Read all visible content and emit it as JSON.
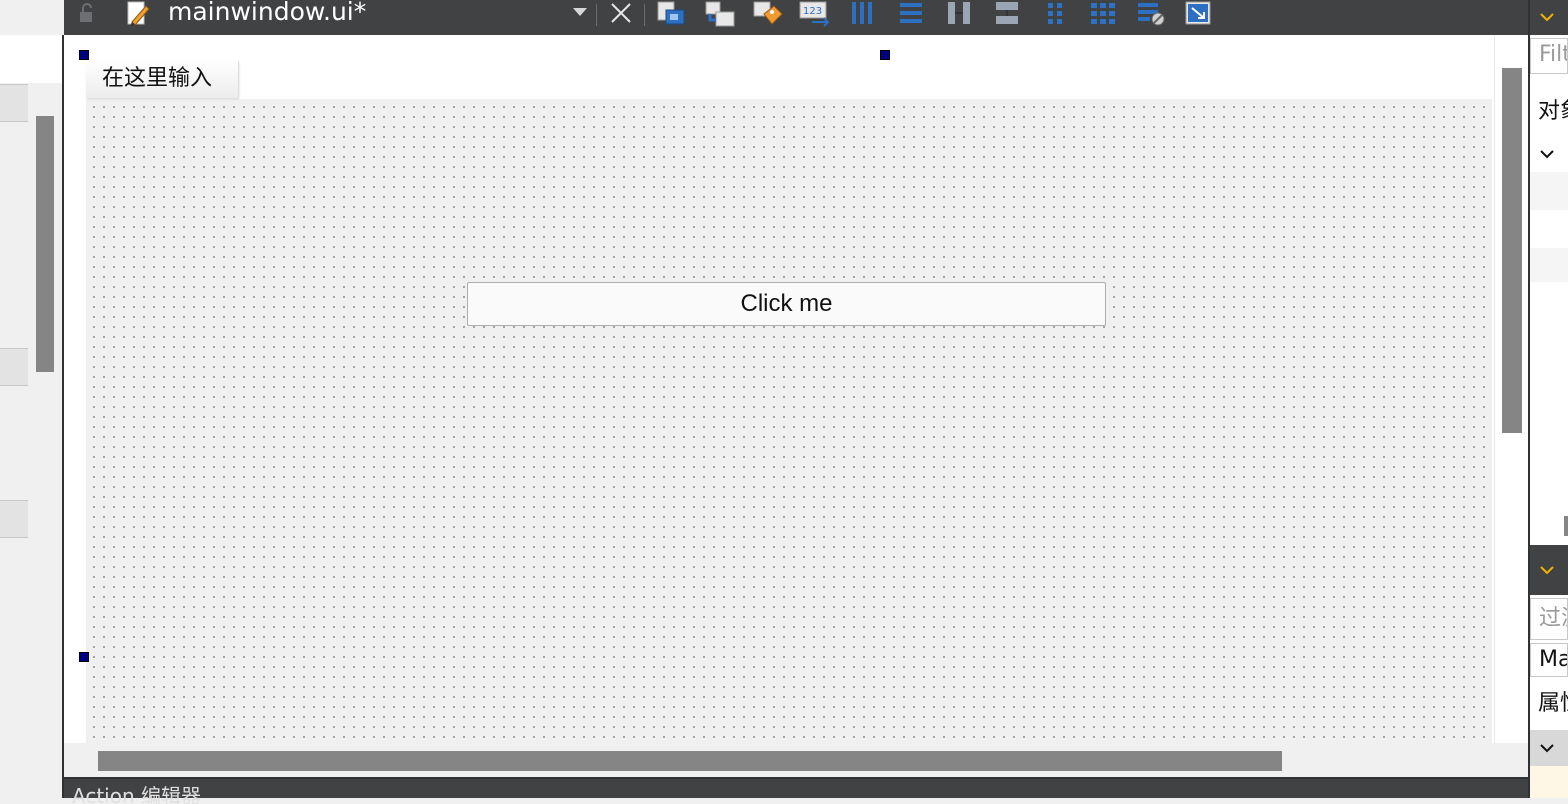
{
  "editor": {
    "filename": "mainwindow.ui*",
    "toolbar_icons": [
      "edit-widgets-icon",
      "edit-signals-slots-icon",
      "edit-buddies-icon",
      "edit-tab-order-icon",
      "layout-horizontal-icon",
      "layout-vertical-icon",
      "layout-horizontal-splitter-icon",
      "layout-vertical-splitter-icon",
      "layout-form-icon",
      "layout-grid-icon",
      "break-layout-icon",
      "adjust-size-icon"
    ]
  },
  "form": {
    "menu_placeholder": "在这里输入",
    "button_label": "Click me"
  },
  "bottom_panel": {
    "title": "Action 编辑器"
  },
  "right_panel": {
    "object_filter_placeholder": "Filter",
    "object_header": "对象",
    "property_filter_placeholder": "过滤器",
    "selected_object": "MainWindow",
    "property_header": "属性"
  },
  "colors": {
    "toolbar_bg": "#404244",
    "canvas_bg": "#f0f0f0",
    "selection_handle": "#000080",
    "scrollbar_thumb": "#858585",
    "dock_accent": "#f0b400"
  }
}
